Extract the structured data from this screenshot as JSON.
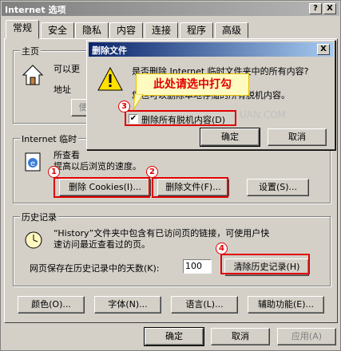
{
  "window": {
    "title": "Internet 选项",
    "help_glyph": "?",
    "close_glyph": "X"
  },
  "tabs": [
    "常规",
    "安全",
    "隐私",
    "内容",
    "连接",
    "程序",
    "高级"
  ],
  "home": {
    "group_label": "主页",
    "desc": "可以更",
    "address_label": "地址",
    "use_current": "使"
  },
  "temp": {
    "group_label": "Internet 临时",
    "line1": "所查看",
    "line2": "提高以后浏览的速度。",
    "delete_cookies": "删除 Cookies(I)...",
    "delete_files": "删除文件(F)...",
    "settings": "设置(S)..."
  },
  "history": {
    "group_label": "历史记录",
    "line1": "“History”文件夹中包含有已访问页的链接，可使用户快",
    "line2": "速访问最近查看过的页。",
    "days_label": "网页保存在历史记录中的天数(K):",
    "days_value": "100",
    "clear": "清除历史记录(H)"
  },
  "bottom_buttons": [
    "颜色(O)...",
    "字体(N)...",
    "语言(L)...",
    "辅助功能(E)..."
  ],
  "footer": {
    "ok": "确定",
    "cancel": "取消",
    "apply": "应用(A)"
  },
  "dialog": {
    "title": "删除文件",
    "close_glyph": "X",
    "line1": "是否删除 Internet 临时文件夹中的所有内容?",
    "line2": "您也可以删除本地存储的所有脱机内容。",
    "checkbox_label": "删除所有脱机内容(D)",
    "checkbox_checked": "✔",
    "ok": "确定",
    "cancel": "取消"
  },
  "annotation": {
    "callout": "此处请选中打勾",
    "markers": [
      "1",
      "2",
      "3",
      "4"
    ],
    "watermark": "UAN.COM"
  }
}
